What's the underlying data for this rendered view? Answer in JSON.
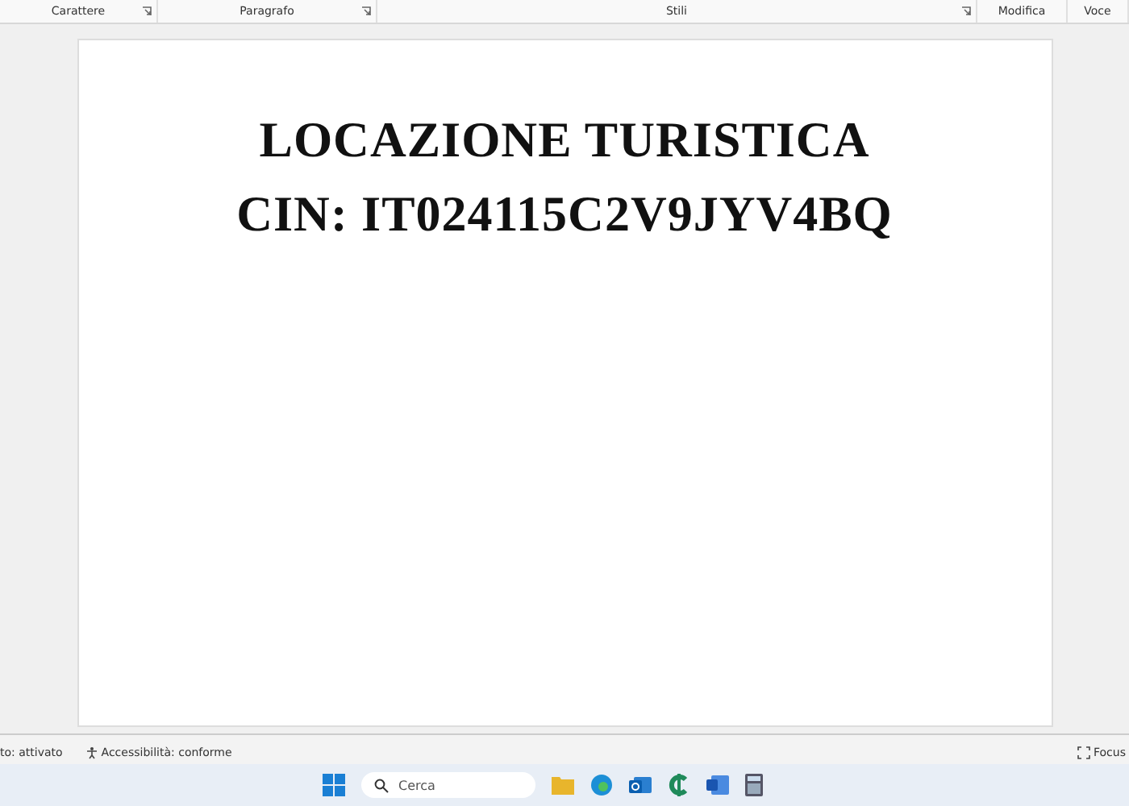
{
  "ribbon": {
    "groups": [
      {
        "label": "Carattere",
        "launcher": true
      },
      {
        "label": "Paragrafo",
        "launcher": true
      },
      {
        "label": "Stili",
        "launcher": true
      },
      {
        "label": "Modifica",
        "launcher": false
      },
      {
        "label": "Voce",
        "launcher": false
      }
    ]
  },
  "document": {
    "lines": [
      "LOCAZIONE TURISTICA",
      "CIN: IT024115C2V9JYV4BQ"
    ]
  },
  "status_bar": {
    "left": "to: attivato",
    "accessibility": "Accessibilità: conforme",
    "focus": "Focus"
  },
  "taskbar": {
    "search": {
      "placeholder": "Cerca"
    }
  }
}
